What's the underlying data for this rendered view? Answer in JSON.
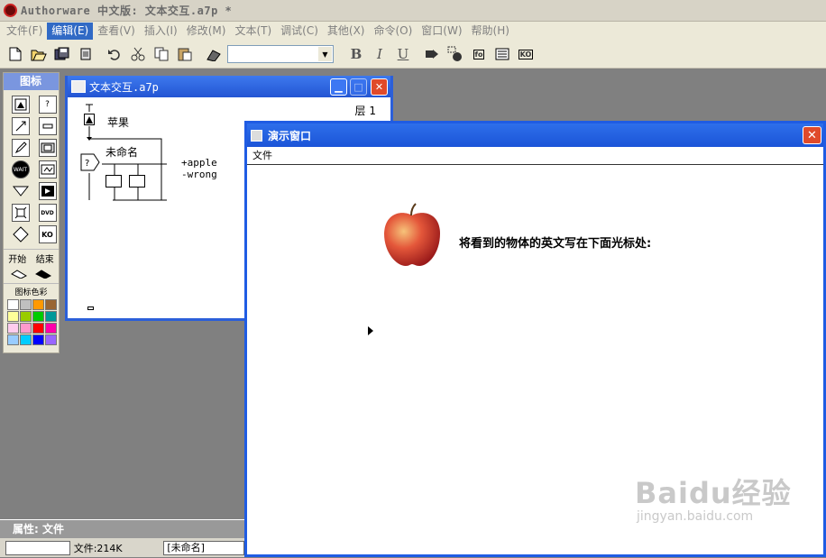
{
  "app": {
    "title": "Authorware 中文版: 文本交互.a7p *"
  },
  "menu": [
    "文件(F)",
    "编辑(E)",
    "查看(V)",
    "插入(I)",
    "修改(M)",
    "文本(T)",
    "调试(C)",
    "其他(X)",
    "命令(O)",
    "窗口(W)",
    "帮助(H)"
  ],
  "toolbar": {
    "bold": "B",
    "italic": "I",
    "underline": "U",
    "fo": "fo",
    "ko": "KO"
  },
  "palette": {
    "title": "图标",
    "icons": [
      "display-icon",
      "decision-icon",
      "motion-icon",
      "erase-icon",
      "wait-icon",
      "navigate-icon",
      "framework-icon",
      "interaction-icon",
      "calculate-icon",
      "map-icon",
      "digital-movie-icon",
      "sound-icon",
      "video-icon",
      "knowledge-object-icon",
      "dvd-icon",
      "ko-icon"
    ],
    "icon_labels": [
      "?",
      "WAIT",
      "DVD",
      "KO"
    ],
    "start": "开始",
    "end": "结束",
    "colors_title": "图标色彩",
    "colors": [
      "#ffffff",
      "#c0c0c0",
      "#ff9900",
      "#996633",
      "#ffff99",
      "#99cc00",
      "#00cc00",
      "#009999",
      "#ffccee",
      "#ff99cc",
      "#ff0000",
      "#ff00aa",
      "#99ccff",
      "#00ccff",
      "#0000ff",
      "#9966ff"
    ]
  },
  "flow": {
    "title": "文本交互.a7p",
    "level": "层 1",
    "node1": "苹果",
    "node2": "未命名",
    "resp1": "+apple",
    "resp2": "-wrong"
  },
  "present": {
    "title": "演示窗口",
    "menu": "文件",
    "prompt": "将看到的物体的英文写在下面光标处:",
    "watermark": "Baidu经验",
    "watermark_sub": "jingyan.baidu.com"
  },
  "props": {
    "title": "属性: 文件",
    "file": "文件:214K",
    "name": "[未命名]"
  }
}
